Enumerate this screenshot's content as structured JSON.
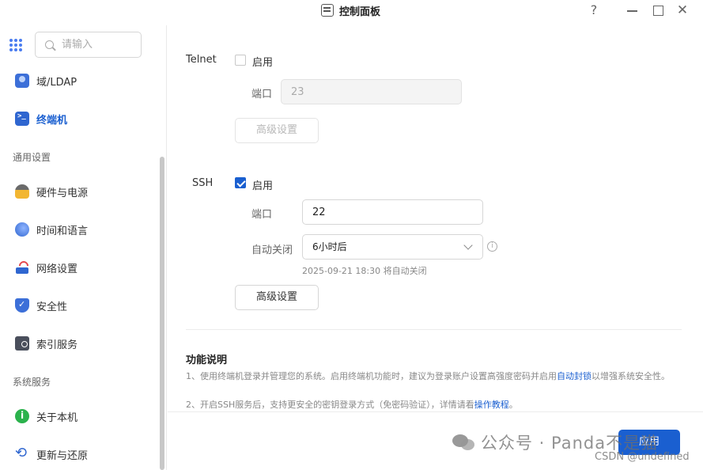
{
  "window": {
    "title": "控制面板",
    "help": "?",
    "close": "✕"
  },
  "sidebar": {
    "search_placeholder": "请输入",
    "items_top": [
      {
        "label": "域/LDAP",
        "icon": "ldap-icon"
      },
      {
        "label": "终端机",
        "icon": "terminal-icon",
        "active": true
      }
    ],
    "section_general": "通用设置",
    "items_general": [
      {
        "label": "硬件与电源",
        "icon": "hardware-icon"
      },
      {
        "label": "时间和语言",
        "icon": "time-icon"
      },
      {
        "label": "网络设置",
        "icon": "network-icon"
      },
      {
        "label": "安全性",
        "icon": "shield-icon"
      },
      {
        "label": "索引服务",
        "icon": "index-icon"
      }
    ],
    "section_system": "系统服务",
    "items_system": [
      {
        "label": "关于本机",
        "icon": "info-icon"
      },
      {
        "label": "更新与还原",
        "icon": "update-icon"
      }
    ]
  },
  "telnet": {
    "title": "Telnet",
    "enable_label": "启用",
    "enabled": false,
    "port_label": "端口",
    "port_value": "23",
    "advanced_label": "高级设置"
  },
  "ssh": {
    "title": "SSH",
    "enable_label": "启用",
    "enabled": true,
    "port_label": "端口",
    "port_value": "22",
    "auto_close_label": "自动关闭",
    "auto_close_value": "6小时后",
    "auto_close_hint": "2025-09-21 18:30 将自动关闭",
    "advanced_label": "高级设置"
  },
  "description": {
    "title": "功能说明",
    "line1_text": "1、使用终端机登录并管理您的系统。启用终端机功能时，建议为登录账户设置高强度密码并启用",
    "line1_link": "自动封锁",
    "line1_tail": "以增强系统安全性。",
    "line2_text": "2、开启SSH服务后，支持更安全的密钥登录方式（免密码验证），详情请看",
    "line2_link": "操作教程",
    "line2_tail": "。"
  },
  "footer": {
    "apply_label": "应用"
  },
  "watermark": {
    "text": "公众号 · Panda不是猫",
    "csdn": "CSDN @undefined"
  },
  "colors": {
    "accent": "#1a5fd0",
    "checkbox_checked": "#1a5fd0"
  }
}
